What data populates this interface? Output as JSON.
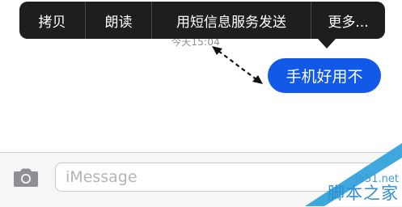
{
  "context_menu": {
    "items": [
      {
        "label": "拷贝"
      },
      {
        "label": "朗读"
      },
      {
        "label": "用短信息服务发送"
      },
      {
        "label": "更多..."
      }
    ]
  },
  "conversation": {
    "timestamp": "今天15:04",
    "message": "手机好用不"
  },
  "composer": {
    "camera_icon": "camera-icon",
    "placeholder": "iMessage"
  },
  "watermark": {
    "url": "jb51.net",
    "name": "脚本之家"
  },
  "colors": {
    "bubble": "#1259e8",
    "menu": "#1e1e1e"
  }
}
